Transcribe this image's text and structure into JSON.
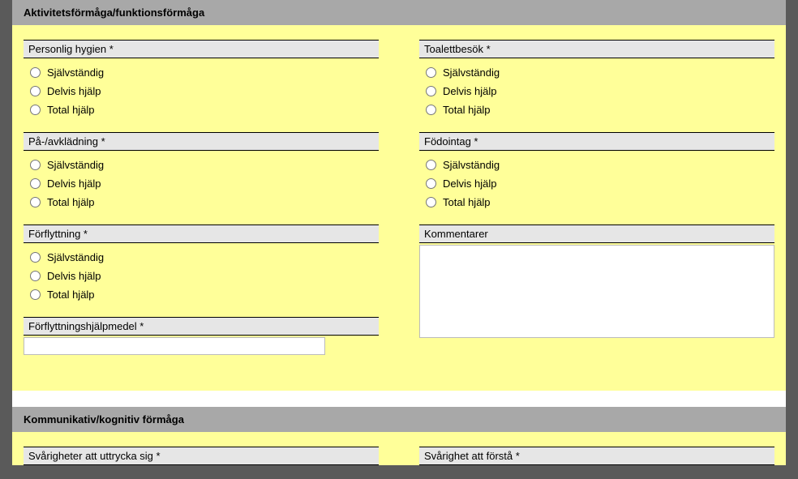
{
  "section1": {
    "title": "Aktivitetsförmåga/funktionsförmåga",
    "left": {
      "group1": {
        "label": "Personlig hygien *",
        "opt1": "Självständig",
        "opt2": "Delvis hjälp",
        "opt3": "Total hjälp"
      },
      "group2": {
        "label": "På-/avklädning *",
        "opt1": "Självständig",
        "opt2": "Delvis hjälp",
        "opt3": "Total hjälp"
      },
      "group3": {
        "label": "Förflyttning *",
        "opt1": "Självständig",
        "opt2": "Delvis hjälp",
        "opt3": "Total hjälp"
      },
      "group4": {
        "label": "Förflyttningshjälpmedel *",
        "value": ""
      }
    },
    "right": {
      "group1": {
        "label": "Toalettbesök *",
        "opt1": "Självständig",
        "opt2": "Delvis hjälp",
        "opt3": "Total hjälp"
      },
      "group2": {
        "label": "Födointag *",
        "opt1": "Självständig",
        "opt2": "Delvis hjälp",
        "opt3": "Total hjälp"
      },
      "group3": {
        "label": "Kommentarer",
        "value": ""
      }
    }
  },
  "section2": {
    "title": "Kommunikativ/kognitiv förmåga",
    "left": {
      "group1": {
        "label": "Svårigheter att uttrycka sig *"
      }
    },
    "right": {
      "group1": {
        "label": "Svårighet att förstå *"
      }
    }
  }
}
